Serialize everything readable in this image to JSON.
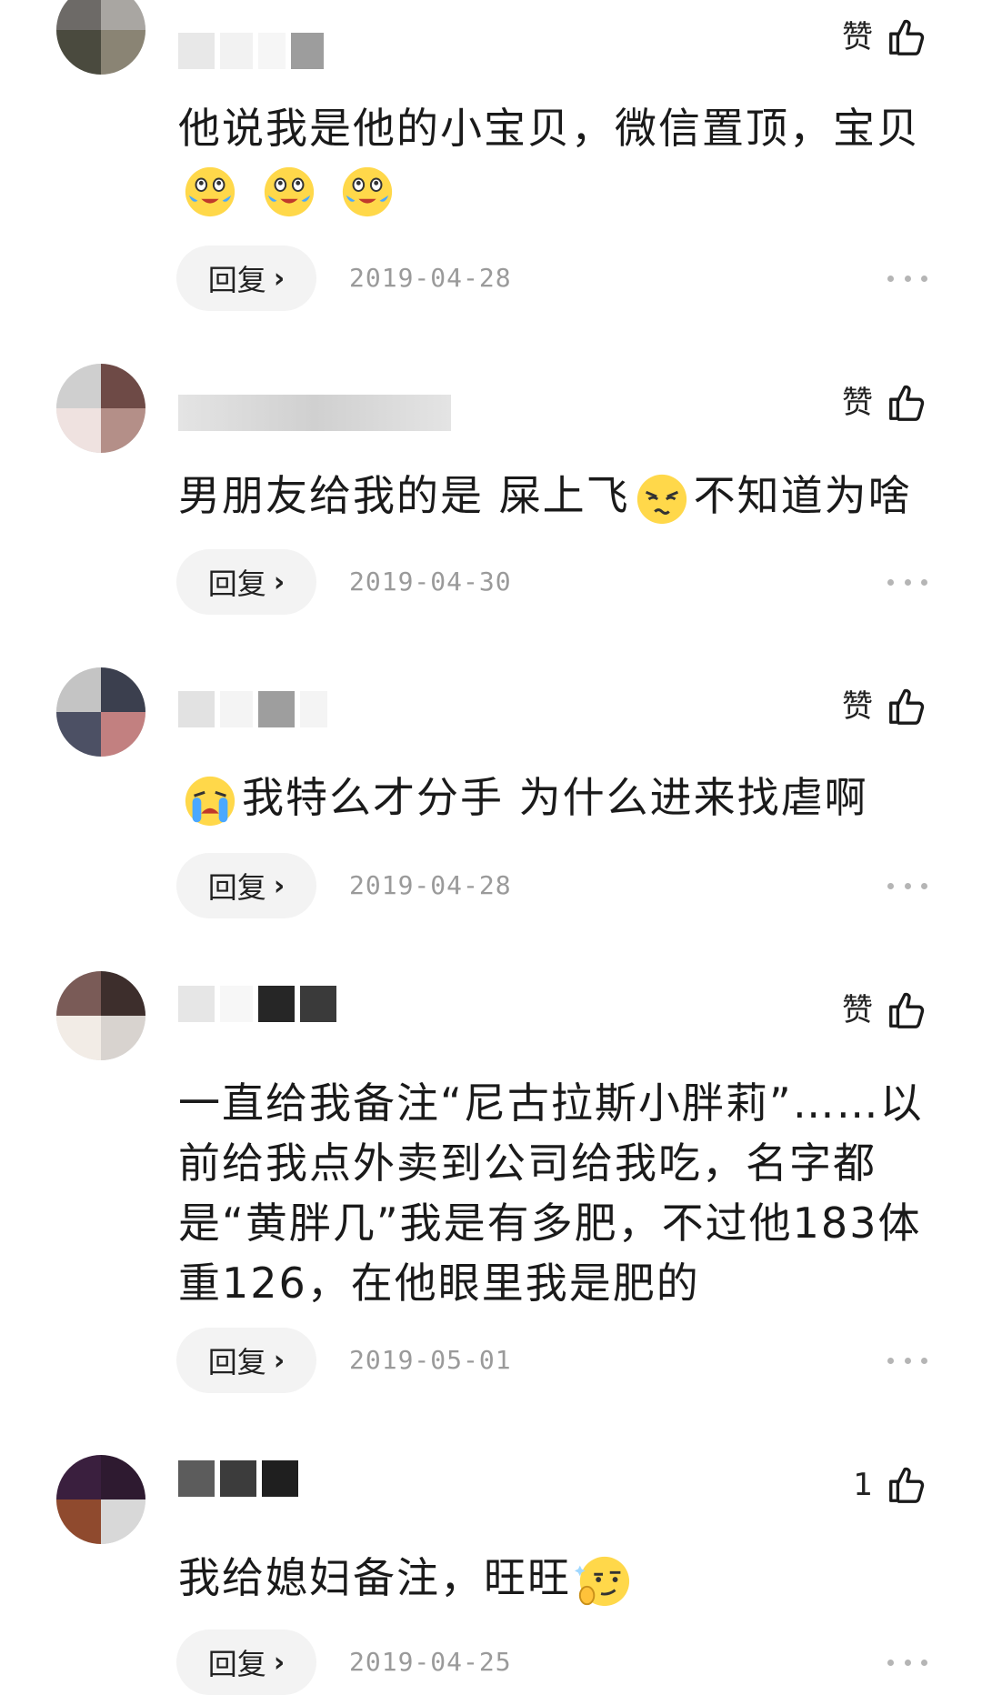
{
  "comments": [
    {
      "like_label": "赞",
      "text": "他说我是他的小宝贝，微信置顶，宝贝",
      "emojis": [
        "crying-laughing",
        "crying-laughing",
        "crying-laughing"
      ],
      "reply_label": "回复",
      "date": "2019-04-28"
    },
    {
      "like_label": "赞",
      "text_before": "男朋友给我的是 屎上飞",
      "text_after": "不知道为啥",
      "emoji": "annoyed-face",
      "reply_label": "回复",
      "date": "2019-04-30"
    },
    {
      "like_label": "赞",
      "text": "我特么才分手 为什么进来找虐啊",
      "emoji": "loud-crying-face",
      "reply_label": "回复",
      "date": "2019-04-28"
    },
    {
      "like_label": "赞",
      "text": "一直给我备注“尼古拉斯小胖莉”……以前给我点外卖到公司给我吃，名字都是“黄胖几”我是有多肥，不过他183体重126，在他眼里我是肥的",
      "reply_label": "回复",
      "date": "2019-05-01"
    },
    {
      "like_count": "1",
      "text": "我给媳妇备注，旺旺",
      "emoji": "thinking-smirk-face",
      "reply_label": "回复",
      "date": "2019-04-25"
    }
  ],
  "colors": {
    "reply_bg": "#f3f3f3",
    "date": "#9a9a9a",
    "more_dots": "#b5b5b5"
  }
}
